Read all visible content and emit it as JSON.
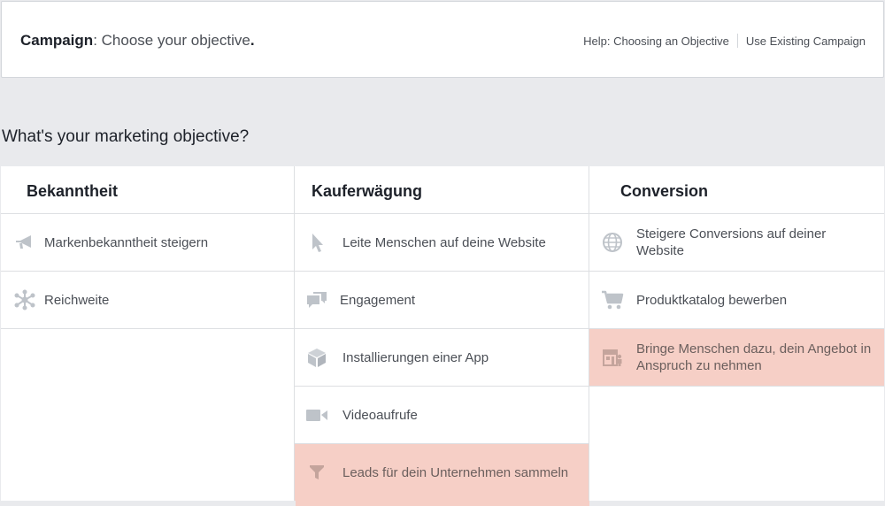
{
  "header": {
    "title_bold": "Campaign",
    "title_rest": ": Choose your objective",
    "title_end": ".",
    "help_link": "Help: Choosing an Objective",
    "existing_link": "Use Existing Campaign"
  },
  "question": "What's your marketing objective?",
  "columns": [
    {
      "title": "Bekanntheit",
      "items": [
        {
          "label": "Markenbekanntheit steigern",
          "icon": "megaphone-icon"
        },
        {
          "label": "Reichweite",
          "icon": "reach-icon"
        }
      ]
    },
    {
      "title": "Kauferwägung",
      "items": [
        {
          "label": "Leite Menschen auf deine Website",
          "icon": "cursor-icon"
        },
        {
          "label": "Engagement",
          "icon": "chat-bubbles-icon"
        },
        {
          "label": "Installierungen einer App",
          "icon": "cube-icon"
        },
        {
          "label": "Videoaufrufe",
          "icon": "video-camera-icon"
        },
        {
          "label": "Leads für dein Unternehmen sammeln",
          "icon": "funnel-icon",
          "selected": true
        }
      ]
    },
    {
      "title": "Conversion",
      "items": [
        {
          "label": "Steigere Conversions auf deiner Website",
          "icon": "globe-icon"
        },
        {
          "label": "Produktkatalog bewerben",
          "icon": "cart-icon"
        },
        {
          "label": "Bringe Menschen dazu, dein Angebot in Anspruch zu nehmen",
          "icon": "store-visit-icon",
          "selected": true
        }
      ]
    }
  ],
  "colors": {
    "icon": "#bec3c9",
    "selected_bg": "#f6cfc6",
    "page_bg": "#e9eaed",
    "border": "#dddfe2"
  }
}
